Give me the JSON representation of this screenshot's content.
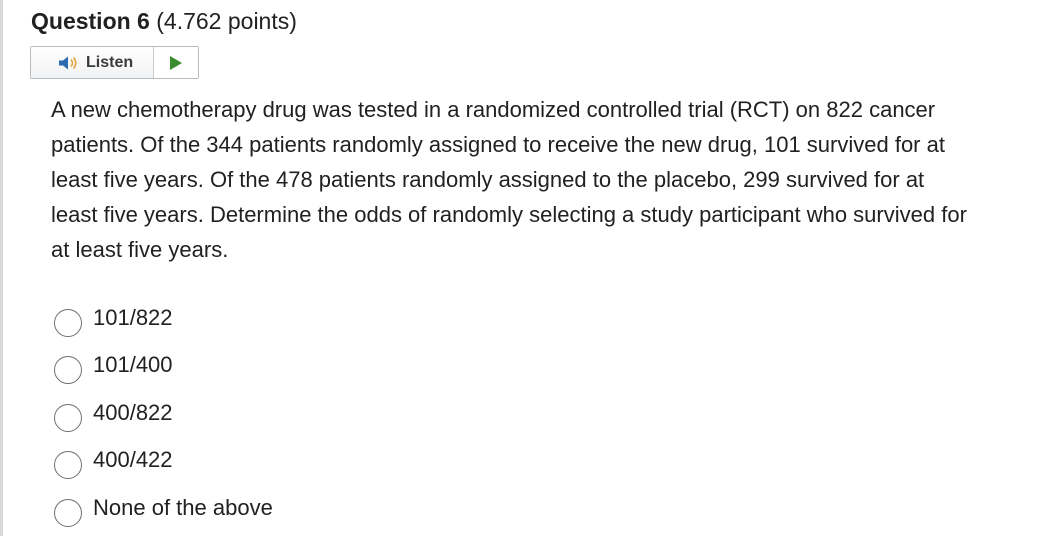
{
  "question": {
    "number_label": "Question 6",
    "points_label": "(4.762 points)",
    "text": "A new chemotherapy drug was tested in a randomized controlled trial (RCT) on 822 cancer patients. Of the 344 patients randomly assigned to receive the new drug, 101 survived for at least five years. Of the 478 patients randomly assigned to the placebo, 299 survived for at least five years. Determine the odds of randomly selecting a study participant who survived for at least five years."
  },
  "listen": {
    "label": "Listen",
    "speaker_icon": "speaker-icon",
    "play_icon": "play-icon"
  },
  "options": [
    {
      "label": "101/822",
      "selected": false
    },
    {
      "label": "101/400",
      "selected": false
    },
    {
      "label": "400/822",
      "selected": false
    },
    {
      "label": "400/422",
      "selected": false
    },
    {
      "label": "None of the above",
      "selected": false
    }
  ],
  "colors": {
    "play_green": "#3a8a2e",
    "speaker_blue": "#2b6cb0"
  }
}
